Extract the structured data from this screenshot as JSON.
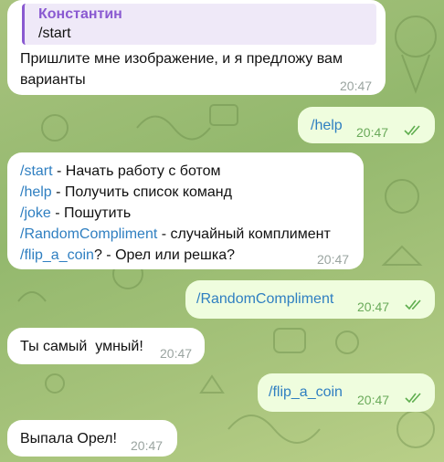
{
  "messages": [
    {
      "reply_to": {
        "name": "Константин",
        "text": "/start"
      },
      "text": "Пришлите мне изображение, и я предложу вам варианты",
      "text_line1": "Пришлите мне изображение, и я предложу вам",
      "text_line2": "варианты",
      "time": "20:47"
    },
    {
      "text": "/help",
      "time": "20:47"
    },
    {
      "lines": [
        {
          "cmd": "/start",
          "rest": " - Начать работу с ботом"
        },
        {
          "cmd": "/help",
          "rest": " - Получить список команд"
        },
        {
          "cmd": "/joke",
          "rest": " - Пошутить"
        },
        {
          "cmd": "/RandomCompliment",
          "rest": " - случайный комплимент"
        },
        {
          "cmd": "/flip_a_coin",
          "rest": "? - Орел или решка?"
        }
      ],
      "time": "20:47"
    },
    {
      "text": "/RandomCompliment",
      "time": "20:47"
    },
    {
      "text": "Ты самый  умный!",
      "time": "20:47"
    },
    {
      "text": "/flip_a_coin",
      "time": "20:47"
    },
    {
      "text": "Выпала Орел!",
      "time": "20:47"
    }
  ],
  "colors": {
    "outgoing_bubble": "#effdde",
    "incoming_bubble": "#ffffff",
    "command_link": "#2f7fc1",
    "reply_accent": "#8a5ad1"
  },
  "icons": {
    "read_receipt": "double-check-icon"
  }
}
